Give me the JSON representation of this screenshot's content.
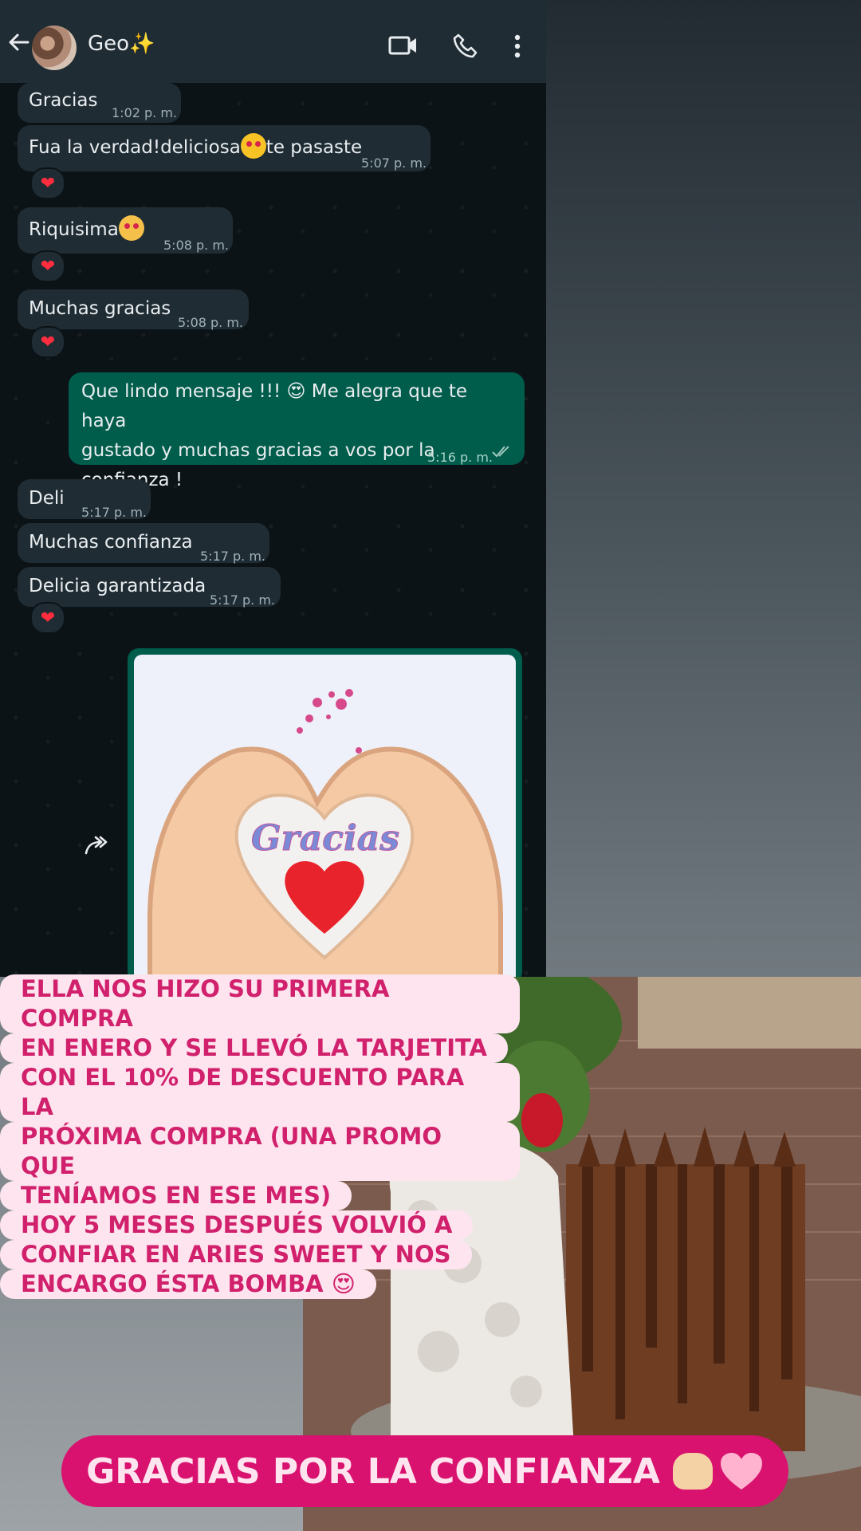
{
  "header": {
    "contact_name": "Geo✨"
  },
  "messages": [
    {
      "text": "Gracias",
      "time": "1:02 p. m.",
      "direction": "in"
    },
    {
      "text_before": "Fua la verdad!deliciosa",
      "text_after": "te pasaste",
      "time": "5:07 p. m.",
      "direction": "in",
      "reaction": "❤"
    },
    {
      "text": "Riquisima",
      "time": "5:08 p. m.",
      "direction": "in",
      "reaction": "❤"
    },
    {
      "text": "Muchas gracias",
      "time": "5:08 p. m.",
      "direction": "in",
      "reaction": "❤"
    },
    {
      "line1": "Que lindo mensaje !!! 😍 Me alegra que te haya",
      "line2": "gustado y muchas gracias a vos por la confianza !",
      "time": "5:16 p. m.",
      "direction": "out",
      "status": "read"
    },
    {
      "text": "Deli",
      "time": "5:17 p. m.",
      "direction": "in"
    },
    {
      "text": "Muchas confianza",
      "time": "5:17 p. m.",
      "direction": "in"
    },
    {
      "text": "Delicia garantizada",
      "time": "5:17 p. m.",
      "direction": "in",
      "reaction": "❤"
    }
  ],
  "image_message": {
    "image_text": "Gracias"
  },
  "caption_lines": [
    "ELLA NOS HIZO SU PRIMERA COMPRA",
    "EN ENERO Y SE LLEVÓ LA TARJETITA",
    "CON EL 10% DE DESCUENTO PARA LA",
    "PRÓXIMA COMPRA (UNA PROMO QUE",
    "TENÍAMOS EN ESE MES)",
    "HOY 5 MESES DESPUÉS VOLVIÓ A",
    "CONFIAR EN ARIES SWEET Y NOS",
    "ENCARGO ÉSTA BOMBA 😍"
  ],
  "banner": {
    "text": "GRACIAS POR LA CONFIANZA"
  },
  "colors": {
    "incoming_bubble": "#1f2c34",
    "outgoing_bubble": "#005c4b",
    "caption_text": "#d1206c",
    "caption_bg": "#fde4ee",
    "banner_bg": "#d8126e"
  }
}
